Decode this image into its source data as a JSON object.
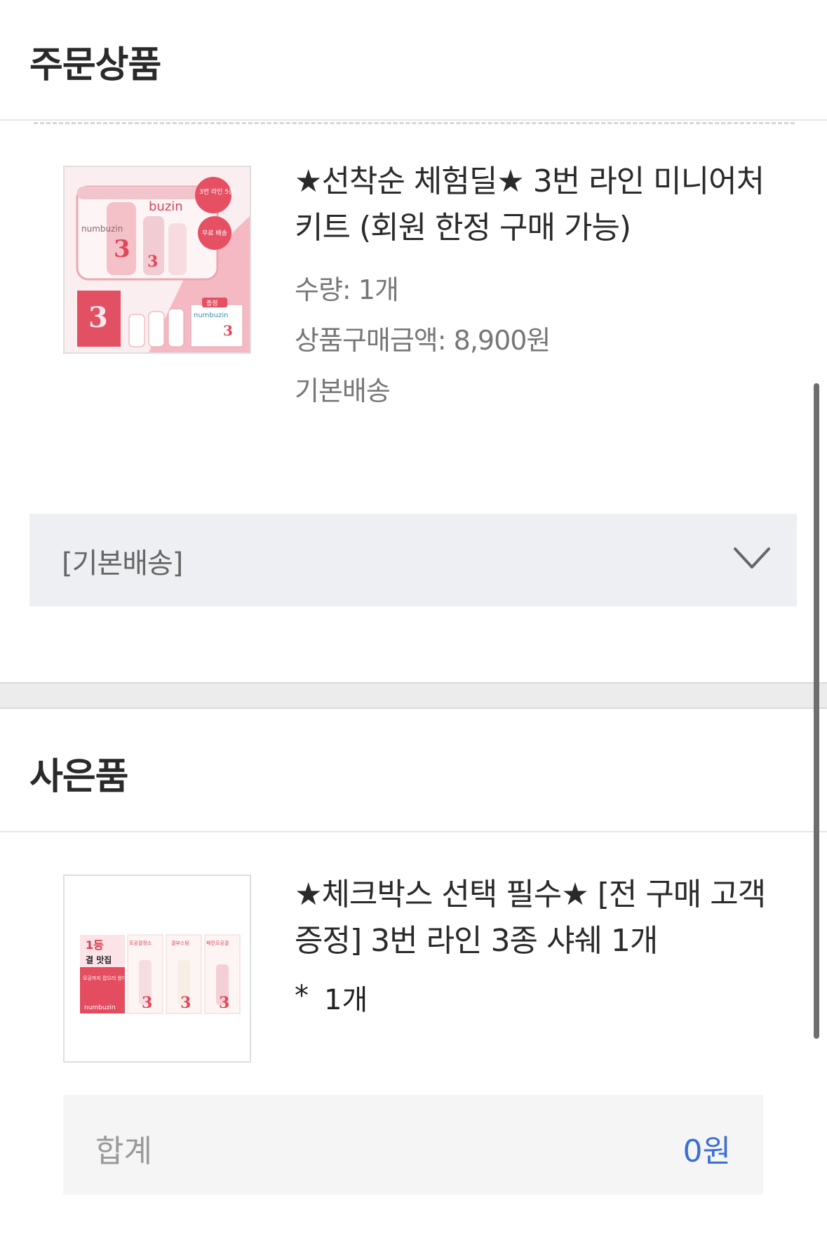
{
  "order_section": {
    "title": "주문상품",
    "product": {
      "name": "★선착순 체험딜★ 3번 라인 미니어처 키트 (회원 한정 구매 가능)",
      "quantity_text": "수량: 1개",
      "price_text": "상품구매금액: 8,900원",
      "shipping_text": "기본배송",
      "image_text": {
        "brand_top": "buzin",
        "brand_line": "numbuzin",
        "badge_line": "3번 라인 5종",
        "badge_free": "무료 배송",
        "gift_tag": "증정",
        "gift_brand": "numbuzin"
      }
    },
    "shipping_select": {
      "value": "[기본배송]"
    }
  },
  "gift_section": {
    "title": "사은품",
    "product": {
      "name": "★체크박스 선택 필수★ [전 구매 고객 증정] 3번 라인 3종 샤쉐 1개",
      "bullet": "*",
      "quantity": "1개",
      "image_text": {
        "rank": "1등",
        "rank_sub": "결 맛집",
        "promo": "모공까지 잡으러 왔다!",
        "brand": "numbuzin",
        "sachet1": "모공결정소",
        "sachet2": "결부스팅",
        "sachet3": "패진모공결"
      }
    },
    "total": {
      "label": "합계",
      "value": "0원"
    }
  },
  "colors": {
    "accent_blue": "#3c6fd6",
    "select_bg": "#eeeff2",
    "brand_pink": "#e0475a"
  }
}
